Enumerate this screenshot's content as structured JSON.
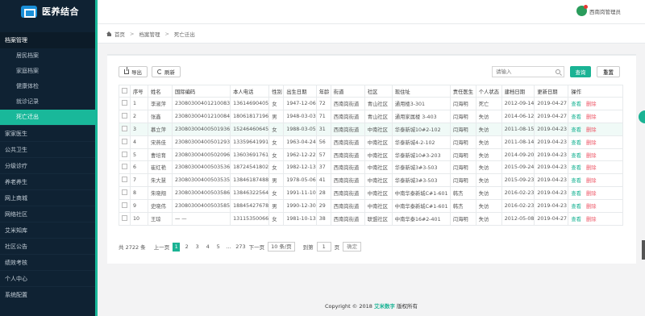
{
  "brand": {
    "name": "医养结合"
  },
  "sidebar": {
    "group_title": "档案管理",
    "sub_items": [
      "居民档案",
      "家庭档案",
      "健康体检",
      "就诊记录",
      "死亡迁出"
    ],
    "main_items": [
      "家家医生",
      "公共卫生",
      "分级诊疗",
      "养老养生",
      "网上商城",
      "网络社区",
      "艾米知库",
      "社区公告",
      "绩效考核",
      "个人中心",
      "系统配置"
    ]
  },
  "topbar": {
    "user": "西南岗管理员"
  },
  "breadcrumb": {
    "home": "首页",
    "level1": "档案管理",
    "level2": "死亡迁出"
  },
  "toolbar": {
    "export": "导出",
    "refresh": "刷新",
    "search_placeholder": "请输入",
    "query": "查询",
    "reset": "重置"
  },
  "table": {
    "headers": [
      "序号",
      "姓名",
      "国际编码",
      "本人电话",
      "性别",
      "出生日期",
      "年龄",
      "街道",
      "社区",
      "现住址",
      "责任医生",
      "个人状态",
      "建档日期",
      "更新日期",
      "操作"
    ],
    "op_view": "查看",
    "op_delete": "删除",
    "rows": [
      [
        "1",
        "李淑萍",
        "23080300401210083",
        "13614690405",
        "女",
        "1947-12-06",
        "72",
        "西南岗街道",
        "青山社区",
        "通用楼3-301",
        "闫海明",
        "死亡",
        "2012-09-14",
        "2019-04-27"
      ],
      [
        "2",
        "张鑫",
        "23080300401210084",
        "18061817196",
        "男",
        "1948-03-03",
        "71",
        "西南岗街道",
        "青山社区",
        "通用家属楼 3-403",
        "闫海明",
        "失访",
        "2014-06-12",
        "2019-04-27"
      ],
      [
        "3",
        "慕立萍",
        "23080300400501936",
        "15246460645",
        "女",
        "1988-03-05",
        "31",
        "西南岗街道",
        "中南社区",
        "华泰新城10#2-102",
        "闫海明",
        "失访",
        "2011-08-15",
        "2019-04-23"
      ],
      [
        "4",
        "宋燕佳",
        "23080300400501293",
        "13359641991",
        "女",
        "1963-04-24",
        "56",
        "西南岗街道",
        "中南社区",
        "华泰新城4-2-102",
        "闫海明",
        "失访",
        "2011-08-14",
        "2019-04-23"
      ],
      [
        "5",
        "曹培育",
        "23080300400502096",
        "13603691761",
        "女",
        "1962-12-22",
        "57",
        "西南岗街道",
        "中南社区",
        "华泰新城10#3-203",
        "闫海明",
        "失访",
        "2014-09-20",
        "2019-04-23"
      ],
      [
        "6",
        "崔红艳",
        "23080300400503536",
        "18724541802",
        "女",
        "1982-12-13",
        "37",
        "西南岗街道",
        "中南社区",
        "华泰新城3#3-503",
        "闫海明",
        "失访",
        "2015-09-24",
        "2019-04-23"
      ],
      [
        "7",
        "朱大慧",
        "23080300400503535",
        "13846187488",
        "男",
        "1978-05-06",
        "41",
        "西南岗街道",
        "中南社区",
        "华泰新城3#3-503",
        "闫海明",
        "失访",
        "2015-09-23",
        "2019-04-23"
      ],
      [
        "8",
        "朱晓翔",
        "23080300400503586",
        "13846322564",
        "女",
        "1991-11-10",
        "28",
        "西南岗街道",
        "中南社区",
        "中南华泰新城C#1-601",
        "韩杰",
        "失访",
        "2016-02-23",
        "2019-04-23"
      ],
      [
        "9",
        "史晓伟",
        "23080300400503585",
        "18845427678",
        "男",
        "1990-12-30",
        "29",
        "西南岗街道",
        "中南社区",
        "中南华泰新城C#1-601",
        "韩杰",
        "失访",
        "2016-02-23",
        "2019-04-23"
      ],
      [
        "10",
        "王琼",
        "— —",
        "13115350066",
        "女",
        "1981-10-13",
        "38",
        "西南岗街道",
        "联盟社区",
        "中南华泰16#2-401",
        "闫海明",
        "失访",
        "2012-05-08",
        "2019-04-27"
      ]
    ]
  },
  "pager": {
    "total": "共 2722 条",
    "prev": "上一页",
    "pages": [
      "1",
      "2",
      "3",
      "4",
      "5",
      "...",
      "273"
    ],
    "next": "下一页",
    "page_size": "10 条/页",
    "goto": "到第",
    "goto_value": "1",
    "page_unit": "页",
    "confirm": "确定"
  },
  "footer": {
    "prefix": "Copyright © 2018",
    "mark": "艾米数字",
    "suffix": "版权所有"
  },
  "colors": {
    "accent": "#1ab394",
    "sidebar_bg": "#0f2233",
    "danger": "#ed5565"
  }
}
